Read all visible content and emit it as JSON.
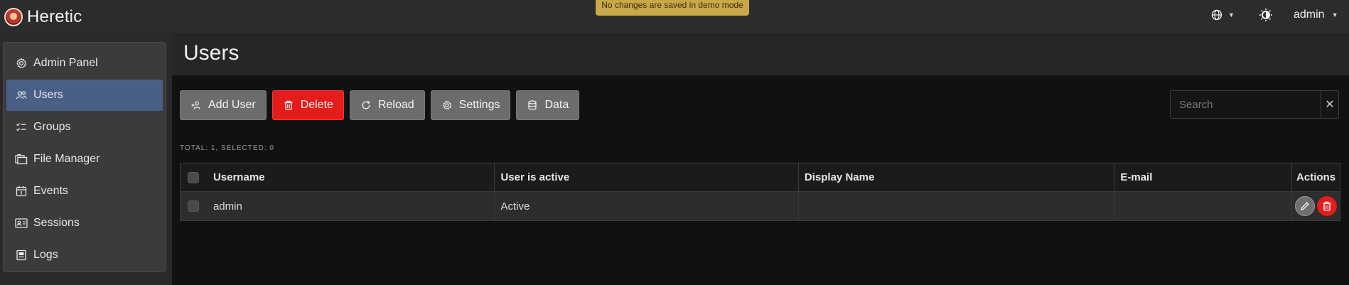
{
  "app": {
    "name": "Heretic",
    "demo_notice": "No changes are saved in demo mode"
  },
  "topbar": {
    "user_label": "admin",
    "language_icon": "globe-icon",
    "theme_icon": "theme-toggle-icon"
  },
  "sidebar": {
    "items": [
      {
        "label": "Admin Panel",
        "icon": "gear-icon",
        "active": false
      },
      {
        "label": "Users",
        "icon": "users-icon",
        "active": true
      },
      {
        "label": "Groups",
        "icon": "groups-icon",
        "active": false
      },
      {
        "label": "File Manager",
        "icon": "folder-icon",
        "active": false
      },
      {
        "label": "Events",
        "icon": "calendar-icon",
        "active": false
      },
      {
        "label": "Sessions",
        "icon": "id-card-icon",
        "active": false
      },
      {
        "label": "Logs",
        "icon": "log-icon",
        "active": false
      }
    ]
  },
  "page": {
    "title": "Users"
  },
  "toolbar": {
    "add_label": "Add User",
    "delete_label": "Delete",
    "reload_label": "Reload",
    "settings_label": "Settings",
    "data_label": "Data"
  },
  "search": {
    "placeholder": "Search",
    "value": ""
  },
  "totals": "TOTAL: 1,  SELECTED: 0",
  "table": {
    "columns": [
      "Username",
      "User is active",
      "Display Name",
      "E-mail",
      "Actions"
    ],
    "rows": [
      {
        "username": "admin",
        "active": "Active",
        "display_name": "",
        "email": ""
      }
    ]
  },
  "colors": {
    "accent": "#4a5f86",
    "danger": "#e51c1c",
    "banner": "#c9a84a"
  }
}
